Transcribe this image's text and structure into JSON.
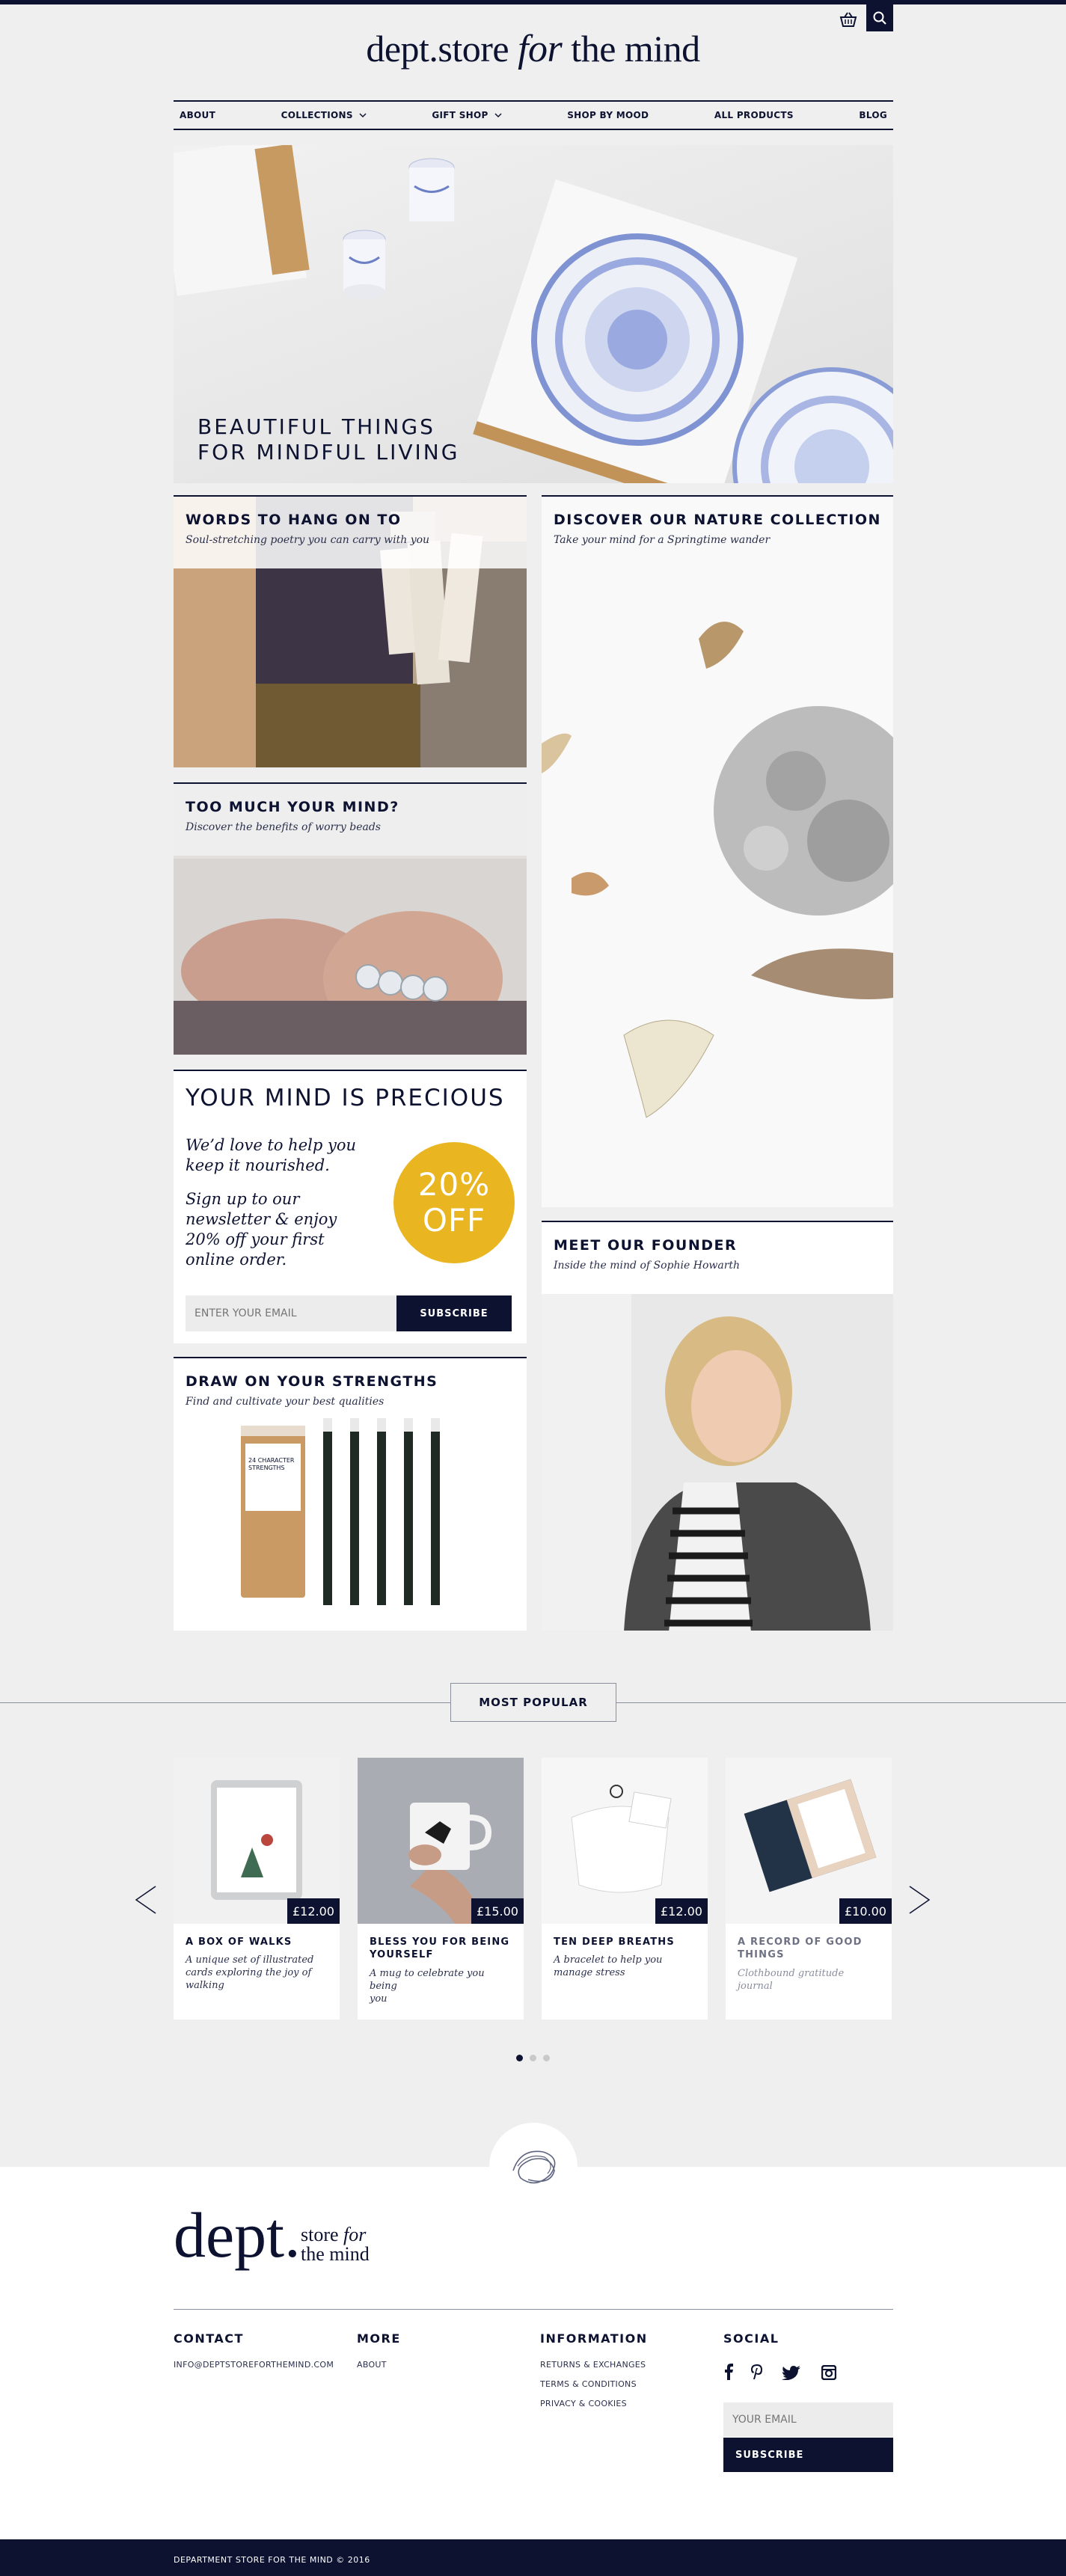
{
  "header": {
    "logo_main": "dept.store",
    "logo_for": "for",
    "logo_rest": "the mind",
    "basket_icon": "basket-icon",
    "search_icon": "search-icon"
  },
  "nav": {
    "items": [
      {
        "label": "ABOUT"
      },
      {
        "label": "COLLECTIONS",
        "dropdown": true
      },
      {
        "label": "GIFT SHOP",
        "dropdown": true
      },
      {
        "label": "SHOP BY MOOD"
      },
      {
        "label": "ALL PRODUCTS"
      },
      {
        "label": "BLOG"
      }
    ]
  },
  "hero": {
    "line1": "BEAUTIFUL THINGS",
    "line2": "FOR MINDFUL LIVING"
  },
  "cards": {
    "words": {
      "title": "WORDS TO HANG ON TO",
      "subtitle": "Soul-stretching poetry you can carry with you"
    },
    "nature": {
      "title": "DISCOVER OUR NATURE COLLECTION",
      "subtitle": "Take your mind for a Springtime wander"
    },
    "mind": {
      "title": "TOO MUCH YOUR MIND?",
      "subtitle": "Discover the benefits of worry beads"
    },
    "founder": {
      "title": "MEET OUR FOUNDER",
      "subtitle": "Inside the mind of Sophie Howarth"
    },
    "strengths": {
      "title": "DRAW ON YOUR STRENGTHS",
      "subtitle": "Find and cultivate your best qualities",
      "box_text": "24 CHARACTER STRENGTHS"
    }
  },
  "newsletter": {
    "title": "YOUR MIND IS PRECIOUS",
    "text1_a": "We’d love to help you",
    "text1_b": "keep it nourished.",
    "text2_a": "Sign up to our",
    "text2_b": "newsletter & enjoy",
    "text2_c": "20% off your first",
    "text2_d": "online order.",
    "badge_a": "20%",
    "badge_b": "OFF",
    "email_placeholder": "ENTER YOUR EMAIL",
    "subscribe": "SUBSCRIBE"
  },
  "popular": {
    "label": "MOST POPULAR",
    "products": [
      {
        "name_a": "A BOX OF WALKS",
        "name_b": "",
        "desc_a": "A unique set of illustrated",
        "desc_b": "cards exploring the joy of",
        "desc_c": "walking",
        "price": "£12.00"
      },
      {
        "name_a": "BLESS YOU FOR BEING",
        "name_b": "YOURSELF",
        "desc_a": "A mug to celebrate you being",
        "desc_b": "you",
        "desc_c": "",
        "price": "£15.00"
      },
      {
        "name_a": "TEN DEEP BREATHS",
        "name_b": "",
        "desc_a": "A bracelet to help you",
        "desc_b": "manage stress",
        "desc_c": "",
        "price": "£12.00"
      },
      {
        "name_a": "A RECORD OF GOOD",
        "name_b": "THINGS",
        "desc_a": "Clothbound gratitude journal",
        "desc_b": "",
        "desc_c": "",
        "price": "£10.00"
      }
    ],
    "prev_icon": "chevron-left-icon",
    "next_icon": "chevron-right-icon",
    "active_dot": 1,
    "dot_count": 3
  },
  "footer": {
    "logo_dept": "dept.",
    "logo_store": "store",
    "logo_for": "for",
    "logo_mind": "the mind",
    "contact_head": "CONTACT",
    "contact_email": "INFO@DEPTSTOREFORTHEMIND.COM",
    "more_head": "MORE",
    "more_about": "ABOUT",
    "info_head": "INFORMATION",
    "info_links": [
      "RETURNS & EXCHANGES",
      "TERMS & CONDITIONS",
      "PRIVACY & COOKIES"
    ],
    "social_head": "SOCIAL",
    "email_placeholder": "YOUR EMAIL",
    "subscribe": "SUBSCRIBE",
    "copyright": "DEPARTMENT STORE FOR THE MIND © 2016"
  },
  "colors": {
    "navy": "#0c1230",
    "gold": "#e9b521",
    "bg": "#efefef"
  }
}
